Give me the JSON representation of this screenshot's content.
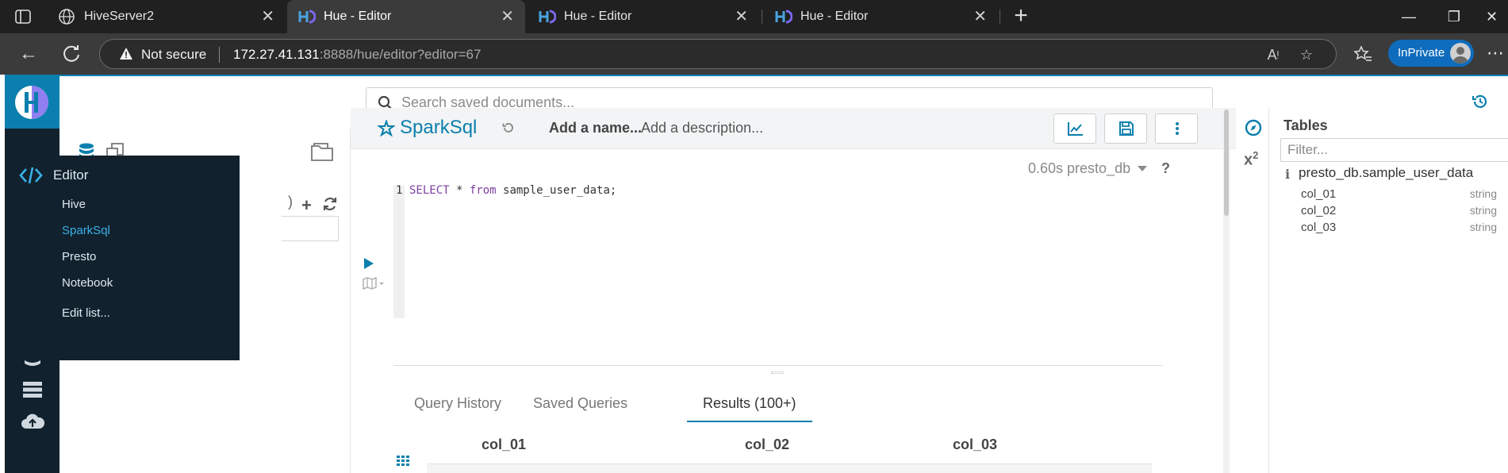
{
  "browser": {
    "tabs": [
      {
        "title": "HiveServer2",
        "active": false
      },
      {
        "title": "Hue - Editor",
        "active": true
      },
      {
        "title": "Hue - Editor",
        "active": false
      },
      {
        "title": "Hue - Editor",
        "active": false
      }
    ],
    "security_label": "Not secure",
    "url_host": "172.27.41.131",
    "url_rest": ":8888/hue/editor?editor=67",
    "inprivate_label": "InPrivate"
  },
  "hue": {
    "search_placeholder": "Search saved documents...",
    "editor_menu": {
      "title": "Editor",
      "items": [
        {
          "label": "Hive",
          "selected": false
        },
        {
          "label": "SparkSql",
          "selected": true
        },
        {
          "label": "Presto",
          "selected": false
        },
        {
          "label": "Notebook",
          "selected": false
        },
        {
          "label": "Edit list...",
          "selected": false
        }
      ]
    },
    "editor": {
      "title": "SparkSql",
      "add_name": "Add a name...",
      "add_description": "Add a description...",
      "exec_info": "0.60s presto_db",
      "help": "?",
      "line_number": "1",
      "code_kw1": "SELECT",
      "code_mid": " * ",
      "code_kw2": "from",
      "code_rest": " sample_user_data;"
    },
    "result_tabs": [
      {
        "label": "Query History",
        "active": false
      },
      {
        "label": "Saved Queries",
        "active": false
      },
      {
        "label": "Results (100+)",
        "active": true
      }
    ],
    "result_columns": [
      "col_01",
      "col_02",
      "col_03"
    ],
    "right_assist": {
      "title": "Tables",
      "filter_placeholder": "Filter...",
      "table_name": "presto_db.sample_user_data",
      "columns": [
        {
          "name": "col_01",
          "type": "string"
        },
        {
          "name": "col_02",
          "type": "string"
        },
        {
          "name": "col_03",
          "type": "string"
        }
      ]
    },
    "colors": {
      "accent": "#0b7fad",
      "nav_bg": "#11222e",
      "menu_selected": "#3ab0e8"
    }
  }
}
